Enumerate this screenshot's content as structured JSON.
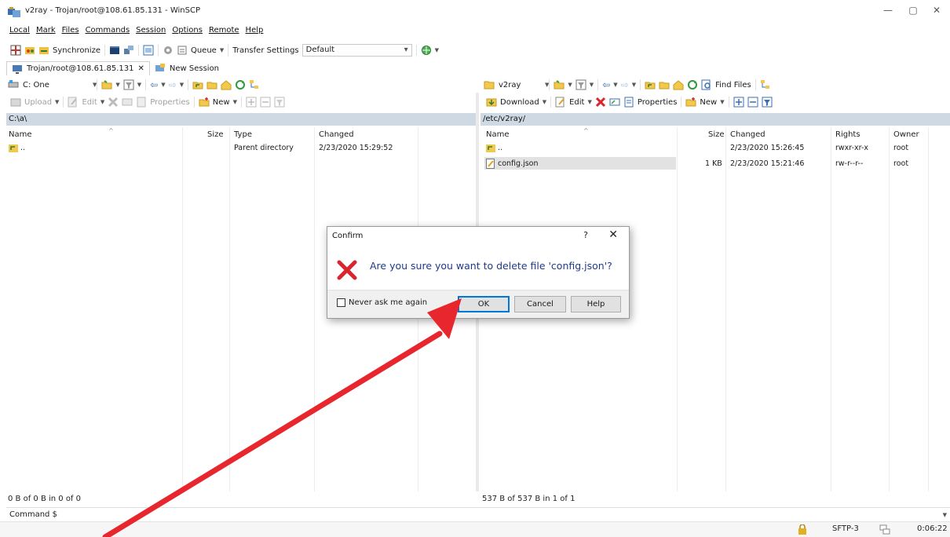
{
  "window": {
    "title": "v2ray - Trojan/root@108.61.85.131 - WinSCP",
    "controls": {
      "minimize": "—",
      "maximize": "▢",
      "close": "✕"
    }
  },
  "menu": [
    "Local",
    "Mark",
    "Files",
    "Commands",
    "Session",
    "Options",
    "Remote",
    "Help"
  ],
  "toolbar": {
    "synchronize": "Synchronize",
    "queue": "Queue",
    "transfer_settings_label": "Transfer Settings",
    "transfer_settings_value": "Default"
  },
  "tabs": [
    {
      "label": "Trojan/root@108.61.85.131",
      "close": "✕"
    },
    {
      "label": "New Session"
    }
  ],
  "local": {
    "drive": "C: One",
    "upload": "Upload",
    "edit": "Edit",
    "properties": "Properties",
    "new": "New",
    "path": "C:\\a\\",
    "columns": {
      "name": "Name",
      "size": "Size",
      "type": "Type",
      "changed": "Changed"
    },
    "rows": [
      {
        "name": "..",
        "size": "",
        "type": "Parent directory",
        "changed": "2/23/2020 15:29:52"
      }
    ],
    "status": "0 B of 0 B in 0 of 0"
  },
  "remote": {
    "folder": "v2ray",
    "find_files": "Find Files",
    "download": "Download",
    "edit": "Edit",
    "properties": "Properties",
    "new": "New",
    "path": "/etc/v2ray/",
    "columns": {
      "name": "Name",
      "size": "Size",
      "changed": "Changed",
      "rights": "Rights",
      "owner": "Owner"
    },
    "rows": [
      {
        "name": "..",
        "size": "",
        "changed": "2/23/2020 15:26:45",
        "rights": "rwxr-xr-x",
        "owner": "root"
      },
      {
        "name": "config.json",
        "size": "1 KB",
        "changed": "2/23/2020 15:21:46",
        "rights": "rw-r--r--",
        "owner": "root"
      }
    ],
    "status": "537 B of 537 B in 1 of 1"
  },
  "command": "Command $",
  "bottom": {
    "protocol": "SFTP-3",
    "time": "0:06:22"
  },
  "dialog": {
    "title": "Confirm",
    "help_glyph": "?",
    "close_glyph": "✕",
    "message": "Are you sure you want to delete file 'config.json'?",
    "checkbox_label": "Never ask me again",
    "ok": "OK",
    "cancel": "Cancel",
    "help": "Help"
  },
  "colors": {
    "accent": "#0078d7",
    "path_bar": "#cfd9e3",
    "delete_red": "#d9262c",
    "arrow_red": "#e8262d",
    "dialog_text": "#1f3a8a"
  }
}
